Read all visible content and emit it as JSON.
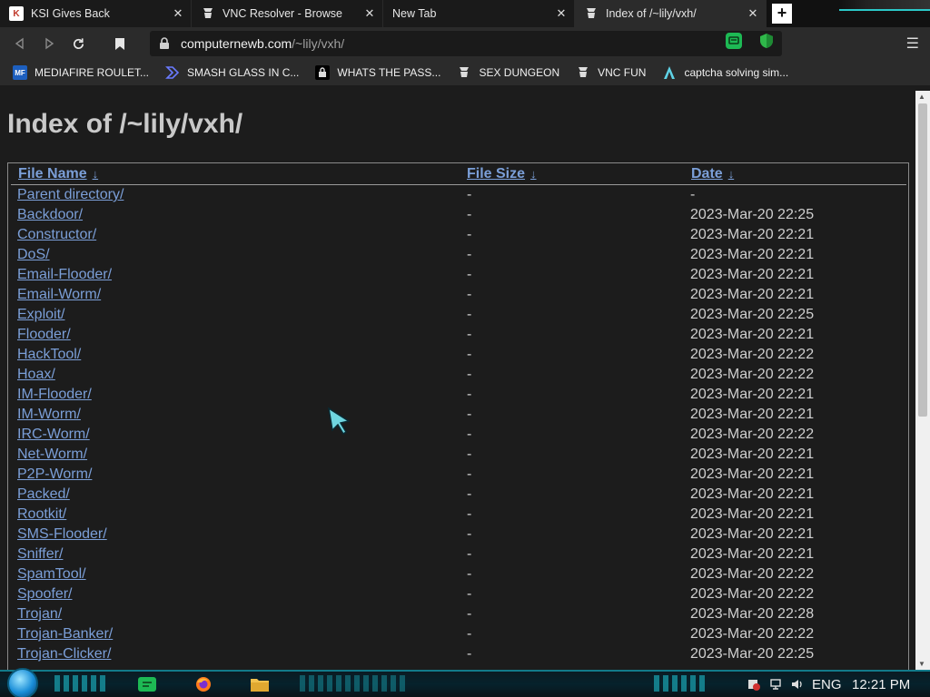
{
  "browser": {
    "tabs": [
      {
        "title": "KSI Gives Back",
        "icon": "ksi-favicon",
        "active": false
      },
      {
        "title": "VNC Resolver - Browse",
        "icon": "vnc-resolver-favicon",
        "active": false
      },
      {
        "title": "New Tab",
        "icon": "",
        "active": false
      },
      {
        "title": "Index of /~lily/vxh/",
        "icon": "directory-favicon",
        "active": true
      }
    ],
    "tab_close_glyph": "✕",
    "new_tab_glyph": "+",
    "url": {
      "host": "computernewb.com",
      "path": "/~lily/vxh/"
    },
    "bookmarks": [
      {
        "label": "MEDIAFIRE ROULET...",
        "icon": "mediafire-icon"
      },
      {
        "label": "SMASH GLASS IN C...",
        "icon": "chevron-bookmark-icon"
      },
      {
        "label": "WHATS THE PASS...",
        "icon": "lock-bookmark-icon"
      },
      {
        "label": "SEX DUNGEON",
        "icon": "vnc-bookmark-icon"
      },
      {
        "label": "VNC FUN",
        "icon": "vnc-bookmark-icon"
      },
      {
        "label": "captcha solving sim...",
        "icon": "arrow-logo-icon"
      }
    ]
  },
  "page": {
    "title": "Index of /~lily/vxh/",
    "columns": {
      "name": "File Name",
      "size": "File Size",
      "date": "Date",
      "sort_arrow": "↓"
    },
    "rows": [
      {
        "name": "Parent directory/",
        "size": "-",
        "date": "-"
      },
      {
        "name": "Backdoor/",
        "size": "-",
        "date": "2023-Mar-20 22:25"
      },
      {
        "name": "Constructor/",
        "size": "-",
        "date": "2023-Mar-20 22:21"
      },
      {
        "name": "DoS/",
        "size": "-",
        "date": "2023-Mar-20 22:21"
      },
      {
        "name": "Email-Flooder/",
        "size": "-",
        "date": "2023-Mar-20 22:21"
      },
      {
        "name": "Email-Worm/",
        "size": "-",
        "date": "2023-Mar-20 22:21"
      },
      {
        "name": "Exploit/",
        "size": "-",
        "date": "2023-Mar-20 22:25"
      },
      {
        "name": "Flooder/",
        "size": "-",
        "date": "2023-Mar-20 22:21"
      },
      {
        "name": "HackTool/",
        "size": "-",
        "date": "2023-Mar-20 22:22"
      },
      {
        "name": "Hoax/",
        "size": "-",
        "date": "2023-Mar-20 22:22"
      },
      {
        "name": "IM-Flooder/",
        "size": "-",
        "date": "2023-Mar-20 22:21"
      },
      {
        "name": "IM-Worm/",
        "size": "-",
        "date": "2023-Mar-20 22:21"
      },
      {
        "name": "IRC-Worm/",
        "size": "-",
        "date": "2023-Mar-20 22:22"
      },
      {
        "name": "Net-Worm/",
        "size": "-",
        "date": "2023-Mar-20 22:21"
      },
      {
        "name": "P2P-Worm/",
        "size": "-",
        "date": "2023-Mar-20 22:21"
      },
      {
        "name": "Packed/",
        "size": "-",
        "date": "2023-Mar-20 22:21"
      },
      {
        "name": "Rootkit/",
        "size": "-",
        "date": "2023-Mar-20 22:21"
      },
      {
        "name": "SMS-Flooder/",
        "size": "-",
        "date": "2023-Mar-20 22:21"
      },
      {
        "name": "Sniffer/",
        "size": "-",
        "date": "2023-Mar-20 22:21"
      },
      {
        "name": "SpamTool/",
        "size": "-",
        "date": "2023-Mar-20 22:22"
      },
      {
        "name": "Spoofer/",
        "size": "-",
        "date": "2023-Mar-20 22:22"
      },
      {
        "name": "Trojan/",
        "size": "-",
        "date": "2023-Mar-20 22:28"
      },
      {
        "name": "Trojan-Banker/",
        "size": "-",
        "date": "2023-Mar-20 22:22"
      },
      {
        "name": "Trojan-Clicker/",
        "size": "-",
        "date": "2023-Mar-20 22:25"
      }
    ]
  },
  "taskbar": {
    "language": "ENG",
    "clock": "12:21 PM",
    "pinned": [
      "start-orb",
      "messaging-app-icon",
      "firefox-icon",
      "file-explorer-icon"
    ]
  },
  "colors": {
    "link": "#7b9fd8",
    "page_bg": "#1c1c1c",
    "chrome_bg": "#2b2b2b",
    "taskbar_accent": "#1ec8d8"
  }
}
